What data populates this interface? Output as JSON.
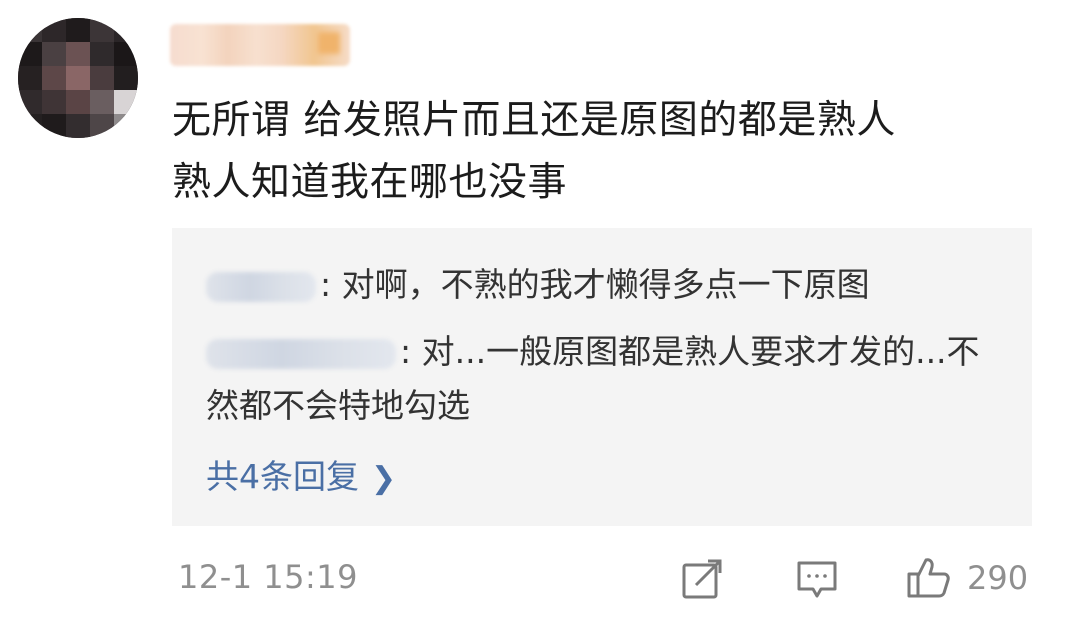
{
  "comment": {
    "username": "",
    "text": "无所谓 给发照片而且还是原图的都是熟人\n熟人知道我在哪也没事"
  },
  "replies": [
    {
      "text": ": 对啊，不熟的我才懒得多点一下原图"
    },
    {
      "text": ": 对...一般原图都是熟人要求才发的...不然都不会特地勾选"
    }
  ],
  "more_replies_label": "共4条回复",
  "footer": {
    "timestamp": "12-1 15:19",
    "like_count": "290"
  },
  "icons": {
    "share": "share-icon",
    "comment": "comment-icon",
    "like": "like-icon",
    "chevron": "chevron-right-icon"
  },
  "colors": {
    "link": "#4a6fa5",
    "reply_background": "#f4f4f4",
    "muted_text": "#8f8f8f"
  }
}
